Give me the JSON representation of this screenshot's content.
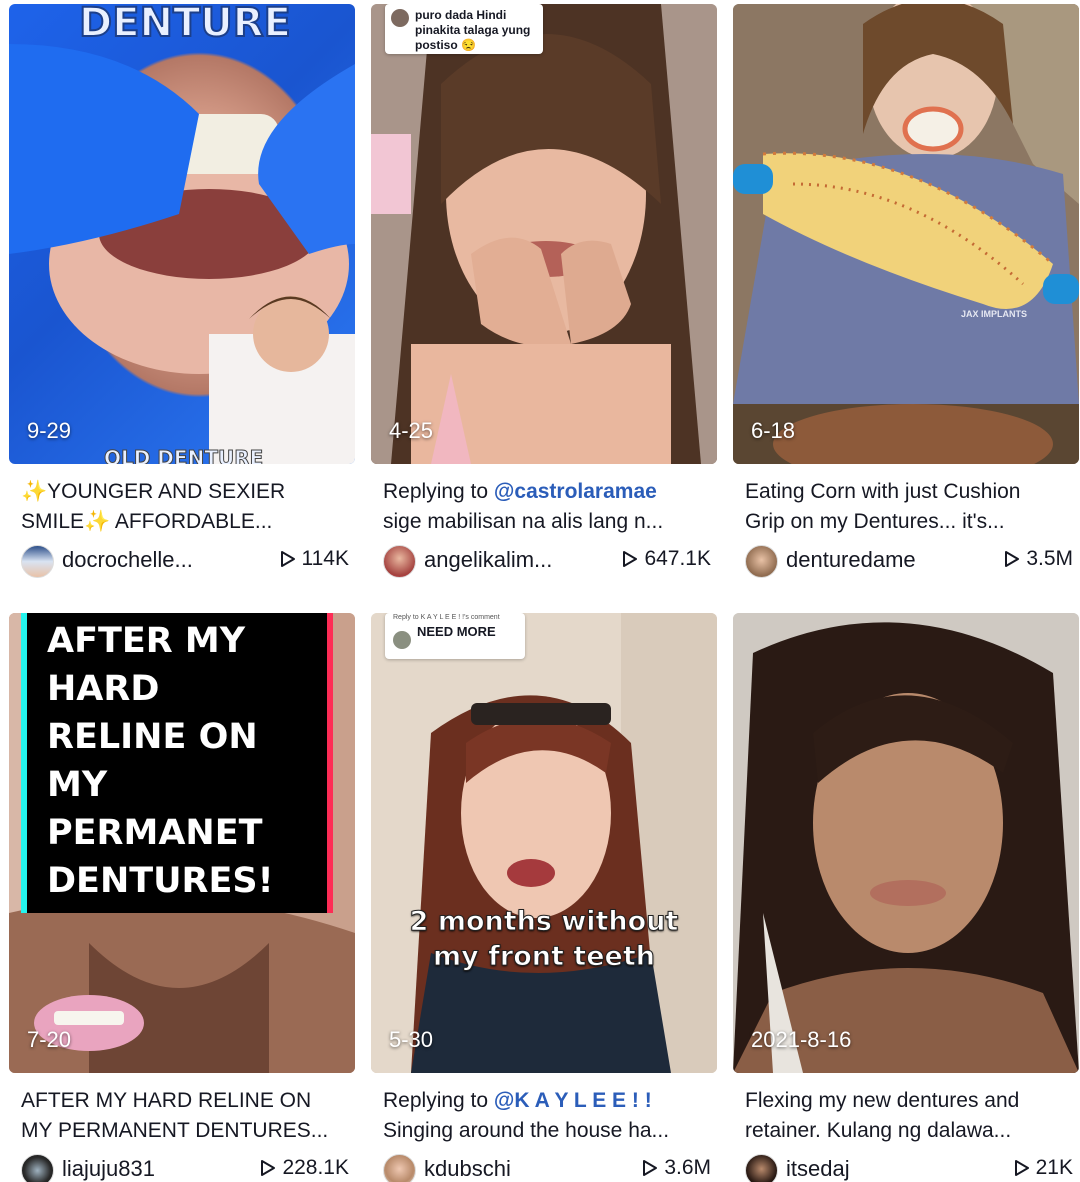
{
  "videos": [
    {
      "date": "9-29",
      "caption_line1": "✨YOUNGER AND SEXIER",
      "caption_line2": "SMILE✨ AFFORDABLE...",
      "author": "docrochelle...",
      "views": "114K",
      "overlay_top": "DENTURE",
      "overlay_bottom": "OLD DENTURE"
    },
    {
      "date": "4-25",
      "caption_prefix": "Replying to ",
      "caption_mention": "@castrolaramae",
      "caption_line2": "sige mabilisan na alis lang n...",
      "author": "angelikalim...",
      "views": "647.1K",
      "reply_bubble": "puro dada Hindi pinakita talaga yung postiso 😒"
    },
    {
      "date": "6-18",
      "caption_line1": "Eating Corn with just Cushion",
      "caption_line2": "Grip on my Dentures... it's...",
      "author": "denturedame",
      "views": "3.5M",
      "shirt_text": "JAX IMPLANTS"
    },
    {
      "date": "7-20",
      "caption_line1": "AFTER MY HARD RELINE ON",
      "caption_line2": "MY PERMANENT DENTURES...",
      "author": "liajuju831",
      "views": "228.1K",
      "overlay_lines": [
        "AFTER MY",
        "HARD",
        "RELINE ON",
        "MY",
        "PERMANET",
        "DENTURES!"
      ]
    },
    {
      "date": "5-30",
      "caption_prefix": "Replying to ",
      "caption_mention": "@K A Y L E E ! !",
      "caption_line2": "Singing around the house ha...",
      "author": "kdubschi",
      "views": "3.6M",
      "reply_small": "Reply to K A Y L E E ! !'s comment",
      "reply_bubble": "NEED MORE",
      "overlay_line1": "2 months without",
      "overlay_line2": "my front teeth"
    },
    {
      "date": "2021-8-16",
      "caption_line1": "Flexing my new dentures and",
      "caption_line2": "retainer. Kulang ng dalawa...",
      "author": "itsedaj",
      "views": "21K"
    }
  ],
  "colors": {
    "mention": "#2b5db9",
    "glove_blue": "#1f6cf0",
    "text": "#161823"
  }
}
